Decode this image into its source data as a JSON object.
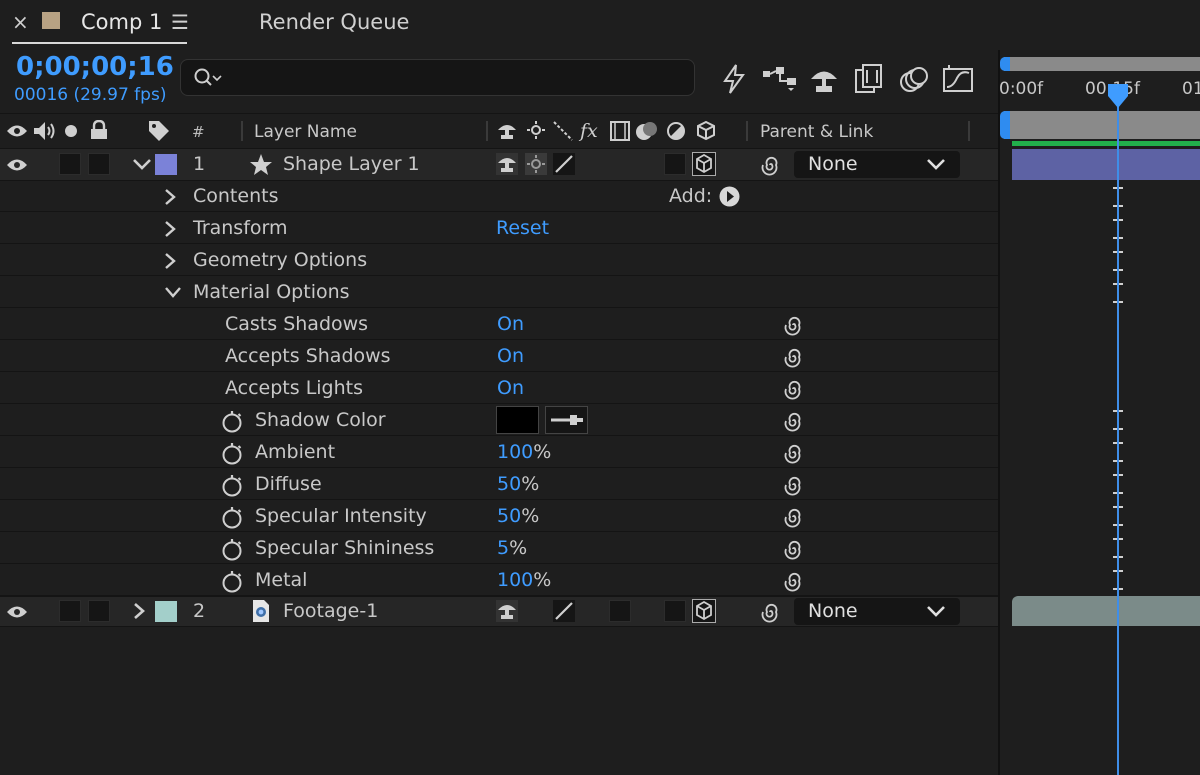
{
  "tabs": {
    "close_glyph": "×",
    "comp_label": "Comp 1",
    "menu_glyph": "☰",
    "render_queue": "Render Queue"
  },
  "time": {
    "timecode": "0;00;00;16",
    "frames": "00016 (29.97 fps)"
  },
  "search": {
    "placeholder": ""
  },
  "columns": {
    "hash": "#",
    "layer_name": "Layer Name",
    "parent_link": "Parent & Link"
  },
  "ruler": {
    "start": "0:00f",
    "mid": "00:15f",
    "end": "01"
  },
  "layers": [
    {
      "index": "1",
      "name": "Shape Layer 1",
      "label_color": "#7b82d8",
      "parent": "None",
      "bar_color": "#5d62a4",
      "props": {
        "contents": "Contents",
        "add_label": "Add:",
        "transform": "Transform",
        "reset": "Reset",
        "geometry": "Geometry Options",
        "material": "Material Options",
        "casts_shadows": {
          "label": "Casts Shadows",
          "value": "On"
        },
        "accepts_shadows": {
          "label": "Accepts Shadows",
          "value": "On"
        },
        "accepts_lights": {
          "label": "Accepts Lights",
          "value": "On"
        },
        "shadow_color": {
          "label": "Shadow Color",
          "color": "#000000"
        },
        "ambient": {
          "label": "Ambient",
          "value": "100",
          "unit": "%"
        },
        "diffuse": {
          "label": "Diffuse",
          "value": "50",
          "unit": "%"
        },
        "specular_intensity": {
          "label": "Specular Intensity",
          "value": "50",
          "unit": "%"
        },
        "specular_shininess": {
          "label": "Specular Shininess",
          "value": "5",
          "unit": "%"
        },
        "metal": {
          "label": "Metal",
          "value": "100",
          "unit": "%"
        }
      }
    },
    {
      "index": "2",
      "name": "Footage-1",
      "label_color": "#a3cfca",
      "parent": "None",
      "bar_color": "#7b8b89"
    }
  ],
  "colors": {
    "accent": "#3f9cff",
    "work_area": "#22b14c"
  },
  "icons": [
    "close-icon",
    "panel-menu-icon",
    "search-icon",
    "draft-3d-icon",
    "flowchart-icon",
    "shy-icon",
    "frame-blending-icon",
    "motion-blur-icon",
    "graph-editor-icon",
    "eye-icon",
    "audio-icon",
    "solo-icon",
    "lock-icon",
    "label-icon",
    "star-icon",
    "footage-icon",
    "stopwatch-icon",
    "pick-whip-icon",
    "eyedropper-icon",
    "cube-icon",
    "chevron-icon"
  ]
}
